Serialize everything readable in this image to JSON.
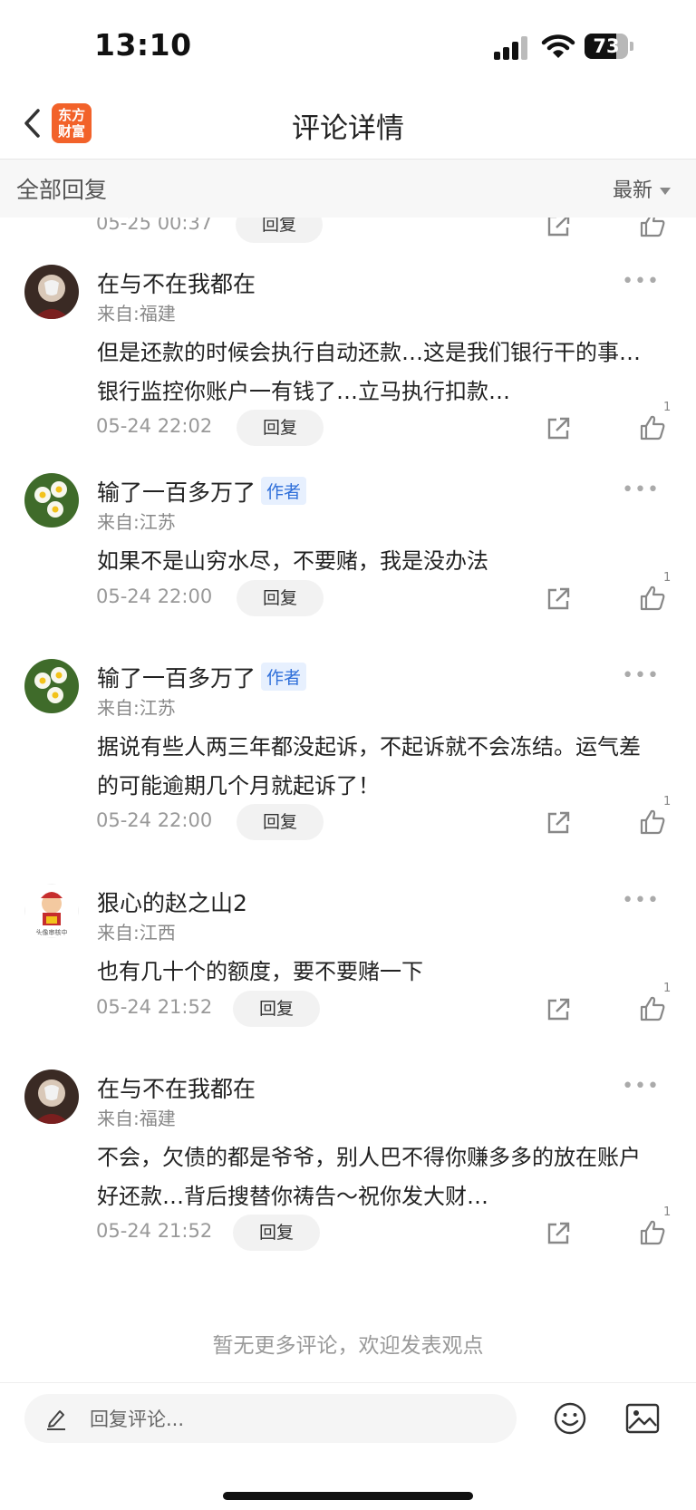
{
  "status_bar": {
    "time": "13:10",
    "battery": "73",
    "battery_level": 0.73
  },
  "nav": {
    "title": "评论详情",
    "logo_line1": "东方",
    "logo_line2": "财富"
  },
  "filter": {
    "label": "全部回复",
    "sort": "最新"
  },
  "partial_row": {
    "date": "05-25 00:37",
    "reply": "回复"
  },
  "comments": [
    {
      "name": "在与不在我都在",
      "author": false,
      "location": "来自:福建",
      "text": "但是还款的时候会执行自动还款…这是我们银行干的事…银行监控你账户一有钱了…立马执行扣款…",
      "date": "05-24 22:02",
      "reply": "回复",
      "likes": "1",
      "avatar": "portrait-mask"
    },
    {
      "name": "输了一百多万了",
      "author": true,
      "author_label": "作者",
      "location": "来自:江苏",
      "text": "如果不是山穷水尽，不要赌，我是没办法",
      "date": "05-24 22:00",
      "reply": "回复",
      "likes": "1",
      "avatar": "narcissus-flowers"
    },
    {
      "name": "输了一百多万了",
      "author": true,
      "author_label": "作者",
      "location": "来自:江苏",
      "text": "据说有些人两三年都没起诉，不起诉就不会冻结。运气差的可能逾期几个月就起诉了！",
      "date": "05-24 22:00",
      "reply": "回复",
      "likes": "1",
      "avatar": "narcissus-flowers"
    },
    {
      "name": "狠心的赵之山2",
      "author": false,
      "location": "来自:江西",
      "text": "也有几十个的额度，要不要赌一下",
      "date": "05-24 21:52",
      "reply": "回复",
      "likes": "1",
      "avatar": "cartoon-pending",
      "avatar_caption": "头像审核中"
    },
    {
      "name": "在与不在我都在",
      "author": false,
      "location": "来自:福建",
      "text": "不会，欠债的都是爷爷，别人巴不得你赚多多的放在账户好还款…背后搜替你祷告～祝你发大财…",
      "date": "05-24 21:52",
      "reply": "回复",
      "likes": "1",
      "avatar": "portrait-mask"
    }
  ],
  "footer_note": "暂无更多评论，欢迎发表观点",
  "bottom_bar": {
    "placeholder": "回复评论..."
  },
  "colors": {
    "brand": "#f2622a",
    "author_badge_bg": "#e7f0fe",
    "author_badge_text": "#2f6fd9"
  }
}
